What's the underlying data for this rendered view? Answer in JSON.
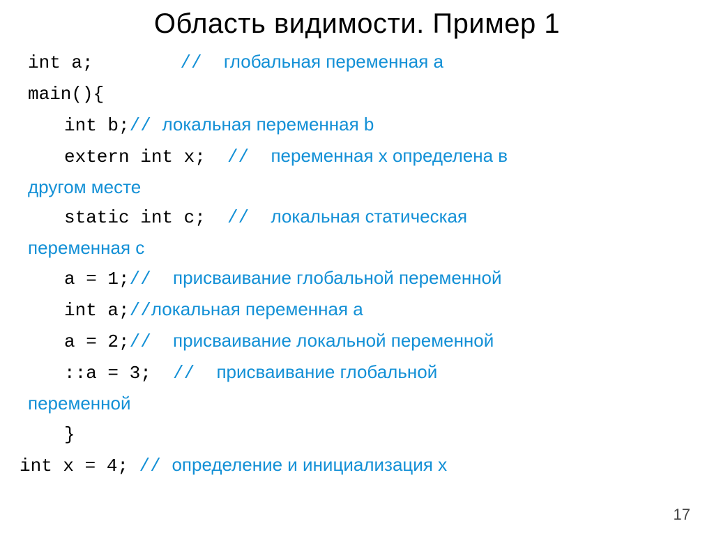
{
  "title": "Область видимости. Пример 1",
  "lines": {
    "l1_code": "int a;        ",
    "l1_comslash": "//  ",
    "l1_comment": "глобальная переменная а",
    "l2_code": "main(){",
    "l3_code": "int b;",
    "l3_comslash": "// ",
    "l3_comment": "локальная переменная b",
    "l4_code": "extern int x;  ",
    "l4_comslash": "//  ",
    "l4_comment": "переменная х определена в",
    "l4b_comment": "другом месте",
    "l5_code": "static int c;  ",
    "l5_comslash": "//  ",
    "l5_comment": "локальная статическая",
    "l5b_comment": "переменная с",
    "l6_code": "a = 1;",
    "l6_comslash": "//  ",
    "l6_comment": "присваивание глобальной переменной",
    "l7_code": "int a;",
    "l7_comslash": "//",
    "l7_comment": "локальная переменная а",
    "l8_code": "a = 2;",
    "l8_comslash": "//  ",
    "l8_comment": "присваивание локальной переменной",
    "l9_code": "::a = 3;  ",
    "l9_comslash": "//  ",
    "l9_comment": "присваивание глобальной",
    "l9b_comment": "переменной",
    "l10_code": "}",
    "l11_code": "int x = 4; ",
    "l11_comslash": "// ",
    "l11_comment": "определение и инициализация х"
  },
  "page_number": "17"
}
